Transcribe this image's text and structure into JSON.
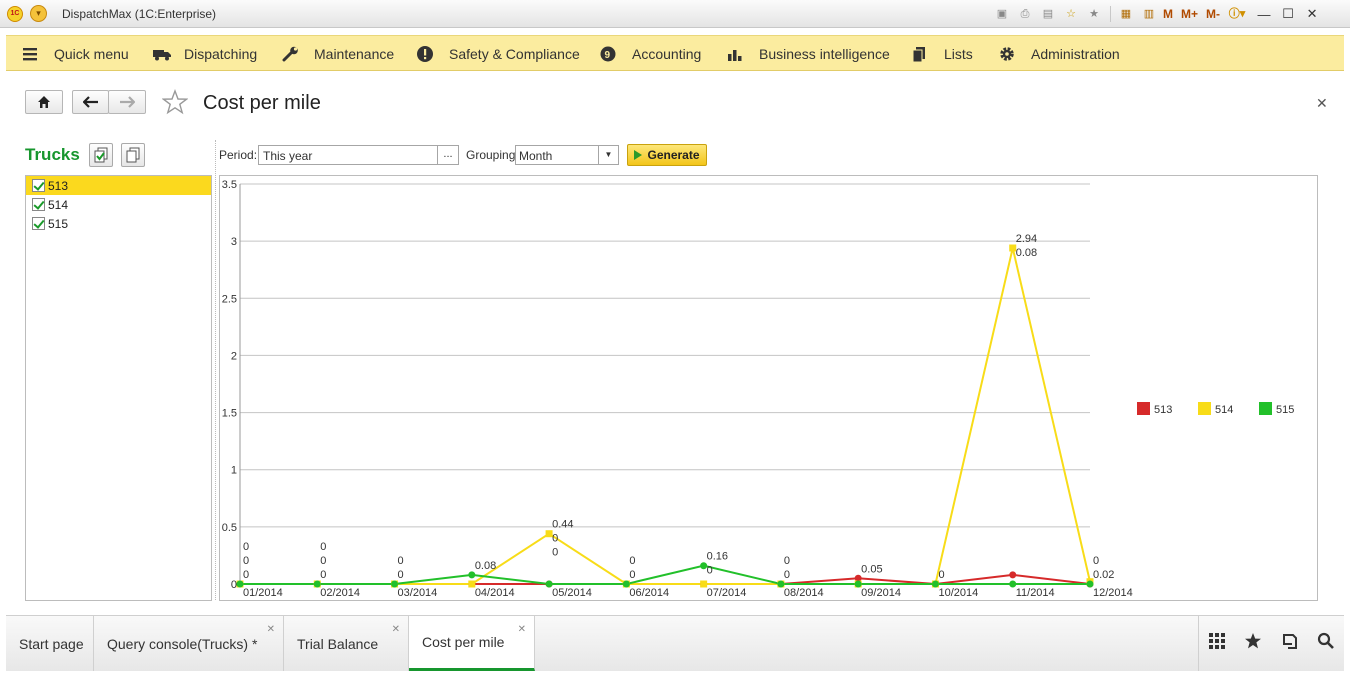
{
  "window": {
    "title": "DispatchMax  (1C:Enterprise)",
    "logo_text": "1C",
    "toolbar_text_icons": [
      "M",
      "M+",
      "M-"
    ]
  },
  "menu": {
    "items": [
      {
        "label": "Quick menu",
        "icon": "hamburger-icon"
      },
      {
        "label": "Dispatching",
        "icon": "truck-icon"
      },
      {
        "label": "Maintenance",
        "icon": "wrench-icon"
      },
      {
        "label": "Safety & Compliance",
        "icon": "exclamation-icon"
      },
      {
        "label": "Accounting",
        "icon": "coins-icon"
      },
      {
        "label": "Business intelligence",
        "icon": "bar-chart-icon"
      },
      {
        "label": "Lists",
        "icon": "documents-icon"
      },
      {
        "label": "Administration",
        "icon": "gear-icon"
      }
    ]
  },
  "page": {
    "title": "Cost per mile"
  },
  "trucks": {
    "title": "Trucks",
    "items": [
      {
        "label": "513",
        "checked": true,
        "selected": true
      },
      {
        "label": "514",
        "checked": true,
        "selected": false
      },
      {
        "label": "515",
        "checked": true,
        "selected": false
      }
    ]
  },
  "controls": {
    "period_label": "Period:",
    "period_value": "This year",
    "period_button": "...",
    "grouping_label": "Grouping:",
    "grouping_value": "Month",
    "generate_label": "Generate"
  },
  "chart_data": {
    "type": "line",
    "categories": [
      "01/2014",
      "02/2014",
      "03/2014",
      "04/2014",
      "05/2014",
      "06/2014",
      "07/2014",
      "08/2014",
      "09/2014",
      "10/2014",
      "11/2014",
      "12/2014"
    ],
    "series": [
      {
        "name": "513",
        "color": "#d62a2a",
        "values": [
          0,
          0,
          0,
          0,
          0,
          0,
          0,
          0,
          0.05,
          0,
          0.08,
          0
        ]
      },
      {
        "name": "514",
        "color": "#f8dc18",
        "values": [
          0,
          0,
          0,
          0,
          0.44,
          0,
          0,
          0,
          0,
          0,
          2.94,
          0.02
        ]
      },
      {
        "name": "515",
        "color": "#22c02a",
        "values": [
          0,
          0,
          0,
          0.08,
          0,
          0,
          0.16,
          0,
          0,
          0,
          0,
          0
        ]
      }
    ],
    "yticks": [
      "0",
      "0.5",
      "1",
      "1.5",
      "2",
      "2.5",
      "3",
      "3.5"
    ],
    "ylim": [
      0,
      3.5
    ],
    "grid": true,
    "legend": "right",
    "point_labels": [
      {
        "category": "01/2014",
        "labels": [
          "0",
          "0",
          "0"
        ]
      },
      {
        "category": "02/2014",
        "labels": [
          "0",
          "0",
          "0"
        ]
      },
      {
        "category": "03/2014",
        "labels": [
          "0",
          "0"
        ]
      },
      {
        "category": "04/2014",
        "labels": [
          "0.08"
        ]
      },
      {
        "category": "05/2014",
        "labels": [
          "0.44",
          "0",
          "0"
        ]
      },
      {
        "category": "06/2014",
        "labels": [
          "0",
          "0"
        ]
      },
      {
        "category": "07/2014",
        "labels": [
          "0.16",
          "0"
        ]
      },
      {
        "category": "08/2014",
        "labels": [
          "0",
          "0"
        ]
      },
      {
        "category": "09/2014",
        "labels": [
          "0.05"
        ]
      },
      {
        "category": "10/2014",
        "labels": [
          "0"
        ]
      },
      {
        "category": "11/2014",
        "labels": [
          "2.94",
          "0.08"
        ]
      },
      {
        "category": "12/2014",
        "labels": [
          "0",
          "0.02"
        ]
      }
    ]
  },
  "tabs": [
    {
      "label": "Start page",
      "closable": false,
      "active": false
    },
    {
      "label": "Query console(Trucks) *",
      "closable": true,
      "active": false
    },
    {
      "label": "Trial Balance",
      "closable": true,
      "active": false
    },
    {
      "label": "Cost per mile",
      "closable": true,
      "active": true
    }
  ],
  "bottom_icons": [
    "grid-icon",
    "star-icon",
    "history-icon",
    "search-icon"
  ]
}
